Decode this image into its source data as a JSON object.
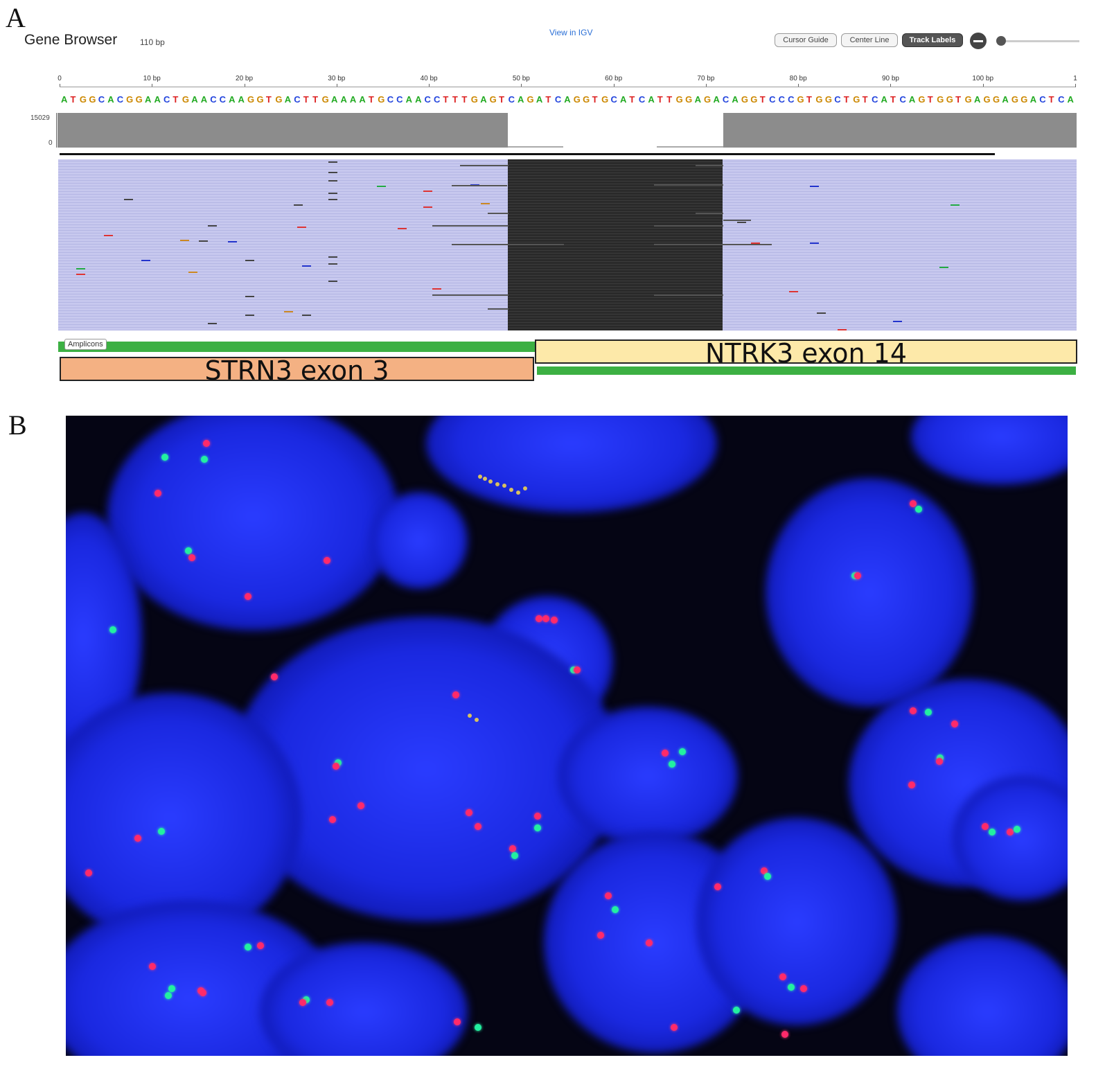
{
  "panels": {
    "a_label": "A",
    "b_label": "B"
  },
  "gene_browser": {
    "title": "Gene Browser",
    "length": "110 bp",
    "igv_link": "View in IGV",
    "buttons": {
      "cursor_guide": "Cursor Guide",
      "center_line": "Center Line",
      "track_labels": "Track Labels"
    },
    "ruler": [
      "0",
      "10 bp",
      "20 bp",
      "30 bp",
      "40 bp",
      "50 bp",
      "60 bp",
      "70 bp",
      "80 bp",
      "90 bp",
      "100 bp",
      "1"
    ],
    "sequence": "ATGGCACGGAACTGAACCAAGGTGACTTGAAAATGCCAACCTTTGAGTCAGATCAGGTGCATCATTGGAGACAGGTCCCGTGGCTGTCATCAGTGGTGAGGAGGACTCA",
    "coverage": {
      "max": "15029",
      "min": "0"
    },
    "amplicons_label": "Amplicons",
    "features": {
      "left": "STRN3 exon 3",
      "right": "NTRK3 exon 14"
    },
    "colors": {
      "A": "#22aa22",
      "C": "#2244dd",
      "G": "#cc8800",
      "T": "#dd2222",
      "read_bg": "#c7c8ee",
      "soft_clip": "#2a2a2a",
      "coverage": "#8c8c8c",
      "strn3": "#f4b183",
      "ntrk3": "#fde9a9",
      "amplicon": "#3cb043"
    }
  }
}
